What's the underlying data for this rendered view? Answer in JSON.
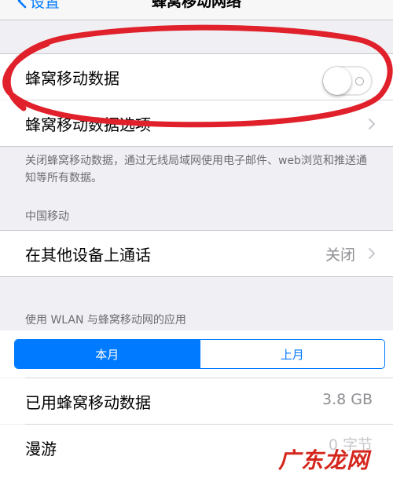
{
  "nav": {
    "back_label": "设置",
    "title": "蜂窝移动网络"
  },
  "cellular": {
    "data_label": "蜂窝移动数据",
    "data_enabled": false,
    "options_label": "蜂窝移动数据选项",
    "footer": "关闭蜂窝移动数据，通过无线局域网使用电子邮件、web浏览和推送通知等所有数据。"
  },
  "carrier": {
    "header": "中国移动",
    "calls_label": "在其他设备上通话",
    "calls_value": "关闭"
  },
  "usage": {
    "header": "使用 WLAN 与蜂窝移动网的应用",
    "segments": [
      "本月",
      "上月"
    ],
    "selected_segment": "本月",
    "used_label": "已用蜂窝移动数据",
    "used_value": "3.8 GB",
    "roaming_label": "漫游",
    "roaming_value": "0 字节"
  },
  "watermark": "广东龙网",
  "colors": {
    "accent": "#007aff",
    "annotation": "#e0202a",
    "watermark": "#d4261c"
  },
  "icons": {
    "back": "chevron-left-icon",
    "disclosure": "chevron-right-icon"
  }
}
